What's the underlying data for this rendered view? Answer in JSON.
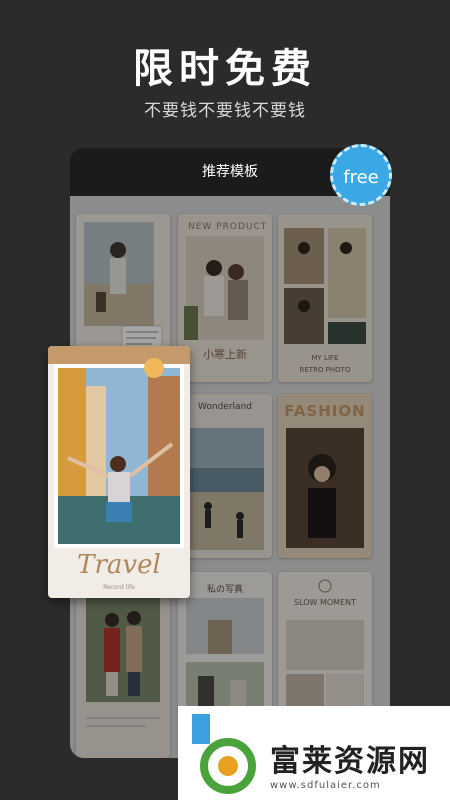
{
  "headline": "限时免费",
  "subline": "不要钱不要钱不要钱",
  "panel_title": "推荐模板",
  "free_badge": "free",
  "templates": {
    "new_product": "NEW PRODUCT",
    "xiaohan": "小寒上新",
    "my_life": "MY LIFE",
    "retro_photo": "RETRO PHOTO",
    "wonderland": "Wonderland",
    "fashion": "FASHION",
    "watashi": "私の写真",
    "slow_moment": "SLOW MOMENT"
  },
  "travel_card": {
    "title": "Travel",
    "subtitle": "Record life"
  },
  "watermark": {
    "text": "富莱资源网",
    "url": "www.sdfulaier.com"
  },
  "colors": {
    "background": "#2b2b2b",
    "badge": "#3ba8e6",
    "travel_title": "#b0865a",
    "fashion": "#c49a6c"
  }
}
